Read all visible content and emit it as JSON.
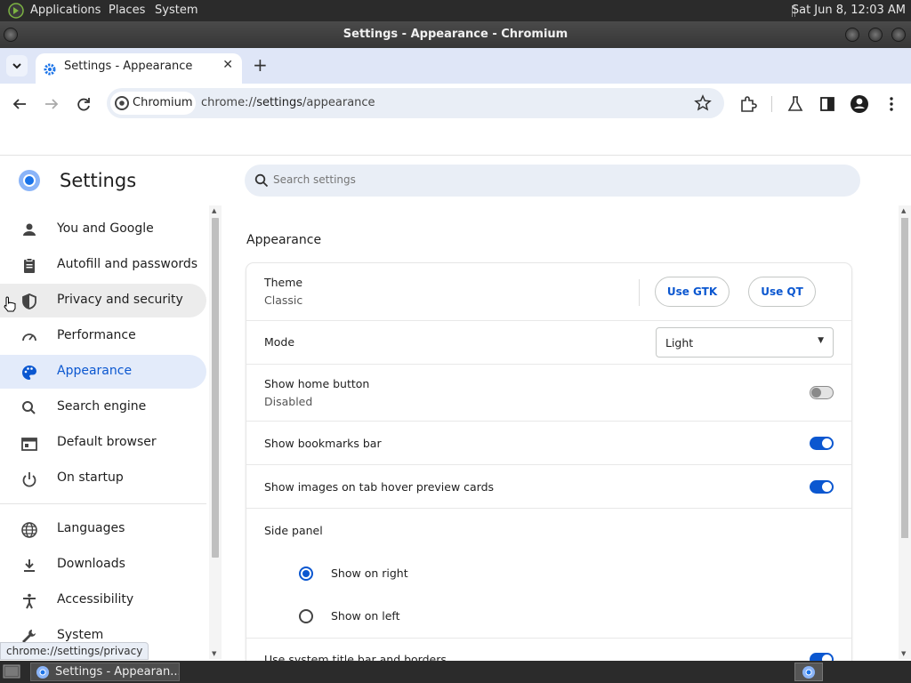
{
  "top_panel": {
    "menus": [
      "Applications",
      "Places",
      "System"
    ],
    "clock": "Sat Jun  8, 12:03 AM"
  },
  "window": {
    "title": "Settings - Appearance - Chromium"
  },
  "tabs": {
    "active_title": "Settings - Appearance",
    "close": "✕",
    "new_tab": "+"
  },
  "toolbar": {
    "site_chip": "Chromium",
    "url_prefix": "chrome://",
    "url_host": "settings",
    "url_path": "/appearance"
  },
  "settings": {
    "title": "Settings",
    "search_placeholder": "Search settings"
  },
  "sidebar": {
    "items": [
      {
        "label": "You and Google",
        "icon": "person-icon"
      },
      {
        "label": "Autofill and passwords",
        "icon": "clipboard-icon"
      },
      {
        "label": "Privacy and security",
        "icon": "shield-icon"
      },
      {
        "label": "Performance",
        "icon": "speedometer-icon"
      },
      {
        "label": "Appearance",
        "icon": "palette-icon"
      },
      {
        "label": "Search engine",
        "icon": "search-icon"
      },
      {
        "label": "Default browser",
        "icon": "browser-icon"
      },
      {
        "label": "On startup",
        "icon": "power-icon"
      },
      {
        "label": "Languages",
        "icon": "globe-icon"
      },
      {
        "label": "Downloads",
        "icon": "download-icon"
      },
      {
        "label": "Accessibility",
        "icon": "accessibility-icon"
      },
      {
        "label": "System",
        "icon": "wrench-icon"
      }
    ]
  },
  "appearance": {
    "section_title": "Appearance",
    "theme_label": "Theme",
    "theme_value": "Classic",
    "use_gtk": "Use GTK",
    "use_qt": "Use QT",
    "mode_label": "Mode",
    "mode_value": "Light",
    "home_button_label": "Show home button",
    "home_button_value": "Disabled",
    "home_button_on": false,
    "bookmarks_bar_label": "Show bookmarks bar",
    "bookmarks_bar_on": true,
    "tab_hover_label": "Show images on tab hover preview cards",
    "tab_hover_on": true,
    "side_panel_label": "Side panel",
    "side_panel_right": "Show on right",
    "side_panel_left": "Show on left",
    "side_panel_selected": "right",
    "system_title_label": "Use system title bar and borders",
    "system_title_on": true
  },
  "status_bubble": "chrome://settings/privacy",
  "taskbar": {
    "item_label": "Settings - Appearan..."
  },
  "colors": {
    "accent": "#0b57d0",
    "active_nav_bg": "#e3ebfa",
    "tabstrip": "#dfe6f7"
  }
}
